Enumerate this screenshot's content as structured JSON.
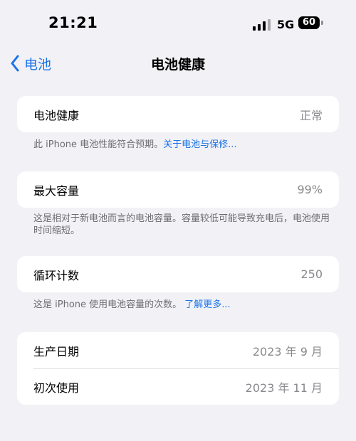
{
  "status_bar": {
    "time": "21:21",
    "network": "5G",
    "battery": "60"
  },
  "nav": {
    "back_label": "电池",
    "title": "电池健康"
  },
  "battery_health": {
    "label": "电池健康",
    "value": "正常",
    "footnote": "此 iPhone 电池性能符合预期。",
    "footnote_link": "关于电池与保修..."
  },
  "max_capacity": {
    "label": "最大容量",
    "value": "99%",
    "footnote": "这是相对于新电池而言的电池容量。容量较低可能导致充电后，电池使用时间缩短。"
  },
  "cycle_count": {
    "label": "循环计数",
    "value": "250",
    "footnote": "这是 iPhone 使用电池容量的次数。",
    "footnote_link": "了解更多..."
  },
  "dates": {
    "manufacture_label": "生产日期",
    "manufacture_value": "2023 年 9 月",
    "first_use_label": "初次使用",
    "first_use_value": "2023 年 11 月"
  },
  "colors": {
    "background": "#f2f2f6",
    "card": "#ffffff",
    "accent": "#1a73e8",
    "secondary_text": "#8a8a8e"
  },
  "icons": {
    "back": "chevron-left-icon",
    "signal": "cellular-signal-icon",
    "battery": "battery-icon"
  }
}
